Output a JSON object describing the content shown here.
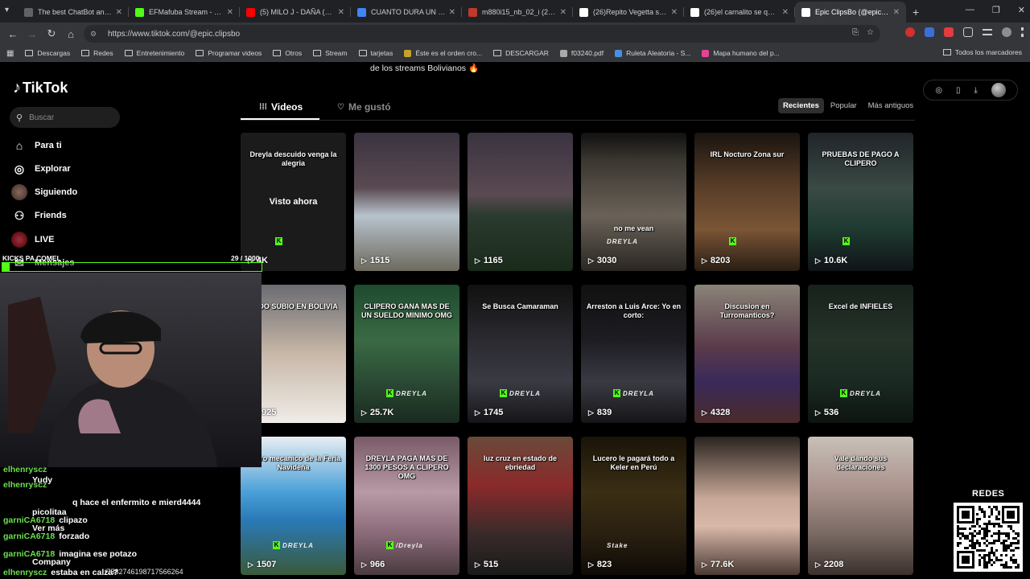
{
  "browser": {
    "tabs": [
      {
        "title": "The best ChatBot and Wi",
        "color": "#5f6368",
        "active": false
      },
      {
        "title": "EFMafuba Stream - Watch",
        "color": "#53fc18",
        "active": false
      },
      {
        "title": "(5) MILO J - DAÑA (ELVIR",
        "color": "#ff0000",
        "active": false
      },
      {
        "title": "CUANTO DURA UN FOUR",
        "color": "#4285f4",
        "active": false
      },
      {
        "title": "m880i15_nb_02_i (2400×",
        "color": "#c0392b",
        "active": false
      },
      {
        "title": "(26)Repito Vegetta se va",
        "color": "#ffffff",
        "active": false
      },
      {
        "title": "(26)el carnalito se quemó",
        "color": "#ffffff",
        "active": false
      },
      {
        "title": "Epic ClipsBo (@epic.clips",
        "color": "#ffffff",
        "active": true
      }
    ],
    "url": "https://www.tiktok.com/@epic.clipsbo",
    "bookmarks": [
      {
        "label": "Descargas",
        "type": "folder"
      },
      {
        "label": "Redes",
        "type": "folder"
      },
      {
        "label": "Entretenimiento",
        "type": "folder"
      },
      {
        "label": "Programar videos",
        "type": "folder"
      },
      {
        "label": "Otros",
        "type": "folder"
      },
      {
        "label": "Stream",
        "type": "folder"
      },
      {
        "label": "tarjetas",
        "type": "folder"
      },
      {
        "label": "Éste es el orden cro...",
        "type": "page",
        "color": "#c9a227"
      },
      {
        "label": "DESCARGAR",
        "type": "folder"
      },
      {
        "label": "f03240.pdf",
        "type": "page",
        "color": "#aaaaaa"
      },
      {
        "label": "Ruleta Aleatoria - S...",
        "type": "page",
        "color": "#4a90e2"
      },
      {
        "label": "Mapa humano del p...",
        "type": "page",
        "color": "#e84393"
      }
    ],
    "bookmarks_right": "Todos los marcadores"
  },
  "tiktok": {
    "logo": "TikTok",
    "search_placeholder": "Buscar",
    "sidebar": [
      {
        "label": "Para ti",
        "icon": "home-icon"
      },
      {
        "label": "Explorar",
        "icon": "compass-icon"
      },
      {
        "label": "Siguiendo",
        "icon": "following-avatar-icon"
      },
      {
        "label": "Friends",
        "icon": "friends-icon"
      },
      {
        "label": "LIVE",
        "icon": "live-icon"
      },
      {
        "label": "Mensajes",
        "icon": "messages-icon"
      }
    ],
    "bio_fragment": "de los streams Bolivianos 🔥",
    "tab_videos": "Videos",
    "tab_liked": "Me gustó",
    "sort": [
      "Recientes",
      "Popular",
      "Más antiguos"
    ],
    "videos": [
      {
        "views": "4K",
        "caption": "Dreyla descuido venga la alegria",
        "overlay": "Visto ahora",
        "bg": "linear-gradient(180deg,#1b1b1b,#0d0d0d)",
        "kick": true
      },
      {
        "views": "1515",
        "caption": "",
        "bg": "linear-gradient(180deg,#3a3340 0%,#5a4a52 40%,#b8c3cc 60%,#6d6a5f 100%)",
        "kick": false
      },
      {
        "views": "1165",
        "caption": "",
        "bg": "linear-gradient(180deg,#3a3340 0%,#5a4a52 45%,#2a3a2e 60%,#1a2a1a 100%)",
        "kick": false
      },
      {
        "views": "3030",
        "caption": "no me vean",
        "bg": "linear-gradient(180deg,#111 0%,#3a3630 20%,#6a6258 60%,#2a2622 100%)",
        "kick": false,
        "wm": "DREYLA"
      },
      {
        "views": "8203",
        "caption": "IRL Nocturo Zona sur",
        "bg": "linear-gradient(180deg,#1a1410 0%,#5a3e28 40%,#7a5536 70%,#2a1e14 100%)",
        "kick": true
      },
      {
        "views": "10.6K",
        "caption": "PRUEBAS DE PAGO A CLIPERO",
        "bg": "linear-gradient(180deg,#20242a 0%,#3a4a44 40%,#1e3a30 70%,#101418 100%)",
        "kick": true
      },
      {
        "views": "4925",
        "caption": "TODO SUBIO EN BOLIVIA",
        "bg": "linear-gradient(180deg,#6b6b72 0%,#c8b8a8 50%,#f0ece8 100%)",
        "kick": false
      },
      {
        "views": "25.7K",
        "caption": "CLIPERO GANA MAS DE UN SUELDO MINIMO OMG",
        "bg": "linear-gradient(180deg,#1e4a2e 0%,#3a6a44 40%,#2a4a34 70%,#1a2a20 100%)",
        "kick": true,
        "wm": "DREYLA"
      },
      {
        "views": "1745",
        "caption": "Se Busca Camaraman",
        "bg": "linear-gradient(180deg,#111 0%,#2a2a30 40%,#3a3a44 70%,#151518 100%)",
        "kick": true,
        "wm": "DREYLA"
      },
      {
        "views": "839",
        "caption": "Arreston a Luis Arce: Yo en corto:",
        "bg": "linear-gradient(180deg,#111 0%,#1c1c22 40%,#3a3a44 70%,#151518 100%)",
        "kick": true,
        "wm": "DREYLA"
      },
      {
        "views": "4328",
        "caption": "Discusion en Turromanticos?",
        "bg": "linear-gradient(180deg,#8a8478 0%,#5a3a4a 45%,#3a2a5a 70%,#4a2a2a 100%)",
        "kick": false
      },
      {
        "views": "536",
        "caption": "Excel de INFIELES",
        "bg": "linear-gradient(180deg,#18221c 0%,#243228 40%,#1a2a22 70%,#0e1410 100%)",
        "kick": true,
        "wm": "DREYLA"
      },
      {
        "views": "1507",
        "caption": "Cobro mecanico de la Feria Navideña",
        "bg": "linear-gradient(180deg,#e8eef2 0%,#4aa0d8 40%,#2a7ab8 60%,#3a5a3a 100%)",
        "kick": true,
        "wm": "DREYLA"
      },
      {
        "views": "966",
        "caption": "DREYLA PAGA MAS DE 1300 PESOS A CLIPERO OMG",
        "bg": "linear-gradient(180deg,#7a5a68 0%,#b89aa6 40%,#8a6a78 70%,#4a3a40 100%)",
        "kick": true,
        "wm": "/Dreyla"
      },
      {
        "views": "515",
        "caption": "luz cruz en estado de ebriedad",
        "bg": "linear-gradient(180deg,#6a4a3a 0%,#8a2a2a 35%,#3a2a2a 70%,#1a1a1a 100%)",
        "kick": false
      },
      {
        "views": "823",
        "caption": "Lucero le pagará todo a Keler en Perú",
        "bg": "linear-gradient(180deg,#1a1408 0%,#3a2e14 40%,#2a2010 70%,#0e0a06 100%)",
        "kick": false,
        "wm": "Stake"
      },
      {
        "views": "77.6K",
        "caption": "",
        "bg": "linear-gradient(180deg,#2a2420 0%,#c8a898 45%,#d8b8a8 65%,#4a3a34 100%)",
        "kick": false
      },
      {
        "views": "2208",
        "caption": "Vale dando sus declaraciones",
        "bg": "linear-gradient(180deg,#c8c0b8 0%,#a8908a 40%,#7a6a64 70%,#3a302c 100%)",
        "kick": false
      }
    ]
  },
  "overlay": {
    "goal_title": "KICKS PA COMEL",
    "goal_count": "29 / 1000",
    "goal_fraction": 0.029,
    "chat": [
      {
        "user": "elhenryscz",
        "text": ""
      },
      {
        "user": "",
        "text": "Yudy"
      },
      {
        "user": "elhenryscz",
        "text": ""
      },
      {
        "user": "",
        "text": "q hace el enfermito e mierd4444"
      },
      {
        "user": "",
        "text": "picolitaa"
      },
      {
        "user": "garniCA6718",
        "text": "clipazo"
      },
      {
        "user": "",
        "text": "Ver más"
      },
      {
        "user": "garniCA6718",
        "text": "forzado"
      },
      {
        "user": "garniCA6718",
        "text": "imagina ese potazo"
      },
      {
        "user": "",
        "text": "Company"
      },
      {
        "user": "elhenryscz",
        "text": "estaba en calza?"
      }
    ],
    "status_url": "/7582746198717566264",
    "qr_label": "REDES"
  }
}
